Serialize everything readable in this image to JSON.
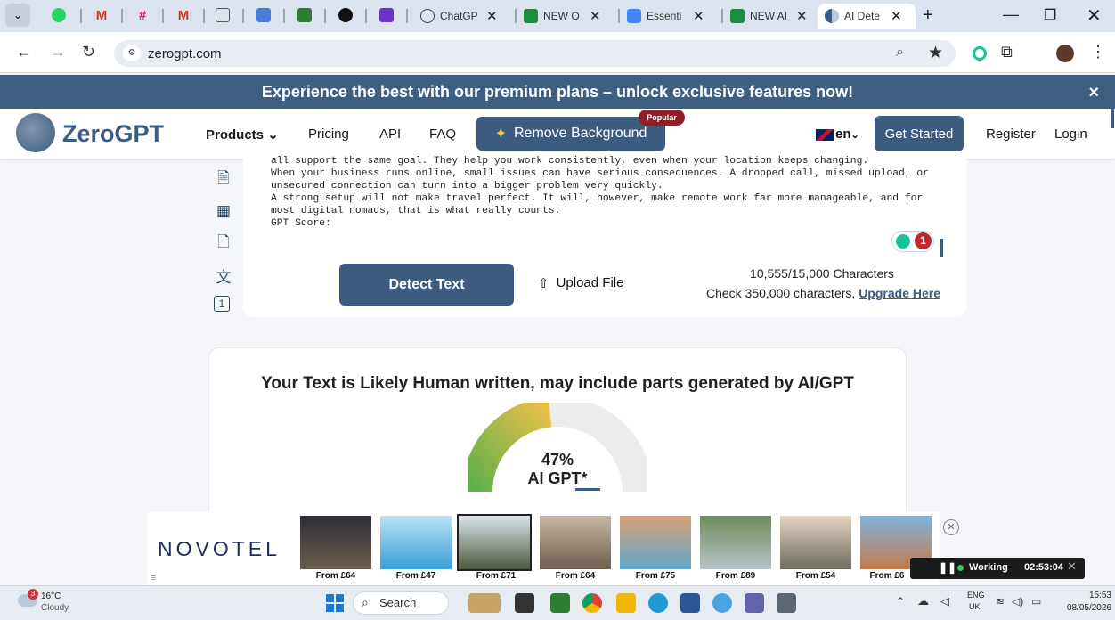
{
  "browser": {
    "tabs": [
      {
        "label": "ChatGP",
        "icon": "chatgpt-icon"
      },
      {
        "label": "NEW O",
        "icon": "sheets-icon"
      },
      {
        "label": "Essenti",
        "icon": "docs-icon"
      },
      {
        "label": "NEW AI",
        "icon": "sheets-icon"
      },
      {
        "label": "AI Dete",
        "icon": "zerogpt-icon"
      }
    ],
    "url": "zerogpt.com"
  },
  "promo": {
    "text": "Experience the best with our premium plans – unlock exclusive features now!",
    "close": "×"
  },
  "header": {
    "logo": "ZeroGPT",
    "nav": {
      "products": "Products",
      "pricing": "Pricing",
      "api": "API",
      "faq": "FAQ"
    },
    "remove_bg": "Remove Background",
    "popular": "Popular",
    "lang": "en",
    "get_started": "Get Started",
    "register": "Register",
    "login": "Login"
  },
  "editor": {
    "lines": [
      "all support the same goal. They help you work consistently, even when your location keeps changing.",
      "When your business runs online, small issues can have serious consequences. A dropped call, missed upload, or",
      "unsecured connection can turn into a bigger problem very quickly.",
      "A strong setup will not make travel perfect. It will, however, make remote work far more manageable, and for",
      "most digital nomads, that is what really counts.",
      "GPT Score:"
    ],
    "badge_count": "1",
    "detect_label": "Detect Text",
    "upload_label": "Upload File",
    "char_count": "10,555/15,000 Characters",
    "upgrade_prefix": "Check 350,000 characters,",
    "upgrade_link": "Upgrade Here"
  },
  "result": {
    "heading": "Your Text is Likely Human written, may include parts generated by AI/GPT",
    "percent": "47%",
    "percent_value": 47,
    "label": "AI GPT*"
  },
  "ad": {
    "brand": "NOVOTEL",
    "prices": [
      "From £64",
      "From £47",
      "From £71",
      "From £64",
      "From £75",
      "From £89",
      "From £54",
      "From £6"
    ]
  },
  "recorder": {
    "status": "Working",
    "time": "02:53:04"
  },
  "taskbar": {
    "weather_temp": "16°C",
    "weather_desc": "Cloudy",
    "weather_badge": "3",
    "search": "Search",
    "lang_top": "ENG",
    "lang_bottom": "UK",
    "time": "15:53",
    "date": "08/05/2026"
  },
  "colors": {
    "primary": "#3b5b7f",
    "promo": "#3d5f82",
    "popular": "#8e1f2b",
    "gauge_green": "#5fb04a",
    "gauge_yellow": "#e8c04a"
  }
}
